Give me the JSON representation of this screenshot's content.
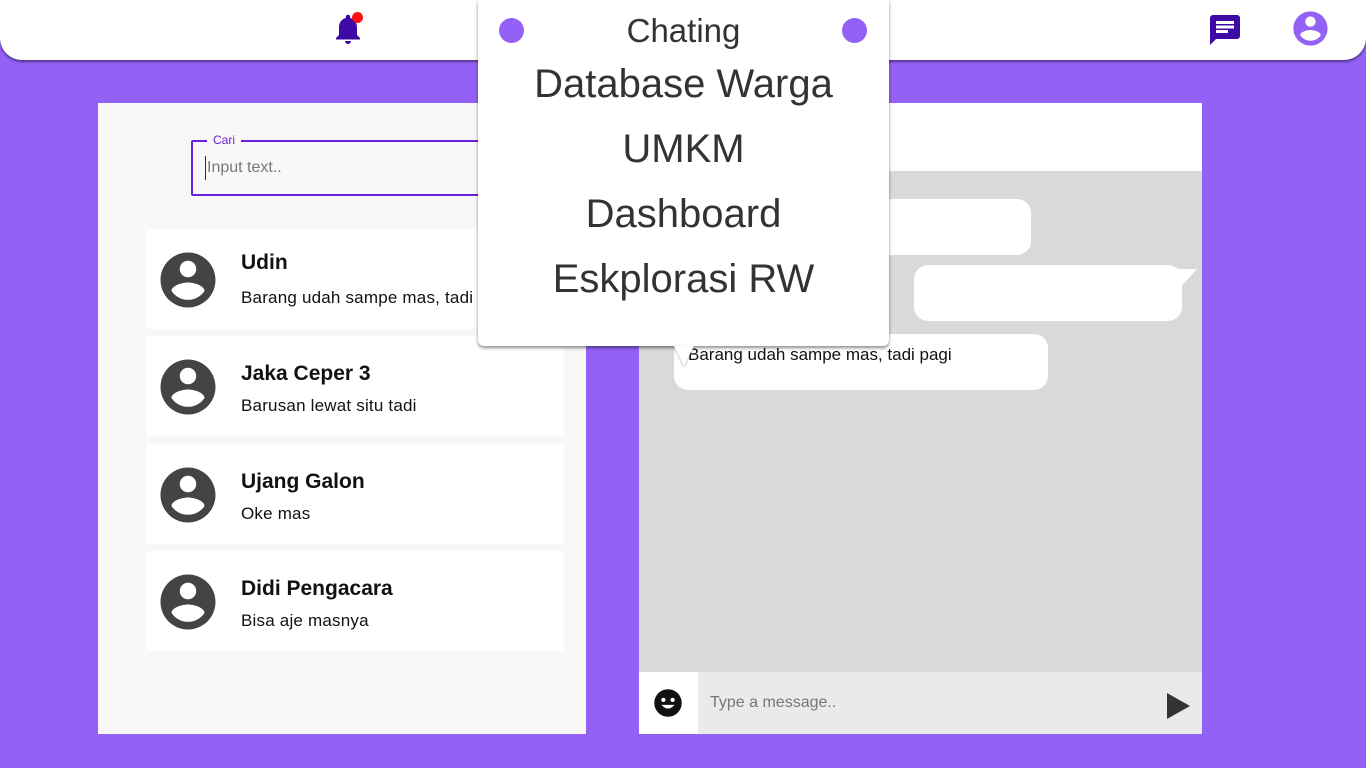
{
  "colors": {
    "background": "#9461f7",
    "accent": "#6a1fd8",
    "icon_dark": "#3d0aa6",
    "notification_dot": "#ff1010"
  },
  "topbar": {
    "icons": [
      "bell-icon",
      "chat-icon",
      "account-circle-icon"
    ]
  },
  "menu": {
    "title": "Chating",
    "items": [
      {
        "label": "Database Warga"
      },
      {
        "label": "UMKM"
      },
      {
        "label": "Dashboard"
      },
      {
        "label": "Eskplorasi RW"
      }
    ]
  },
  "search": {
    "label": "Cari",
    "placeholder": "Input text.."
  },
  "contacts": [
    {
      "name": "Udin",
      "message": "Barang udah sampe mas, tadi pagi"
    },
    {
      "name": "Jaka Ceper 3",
      "message": "Barusan lewat situ tadi"
    },
    {
      "name": "Ujang Galon",
      "message": "Oke mas"
    },
    {
      "name": "Didi Pengacara",
      "message": "Bisa aje masnya"
    }
  ],
  "conversation": {
    "messages": [
      {
        "text": "",
        "side": "left"
      },
      {
        "text": "",
        "side": "right"
      },
      {
        "text": "Barang udah sampe mas, tadi pagi",
        "side": "left"
      }
    ],
    "input_placeholder": "Type a message.."
  }
}
